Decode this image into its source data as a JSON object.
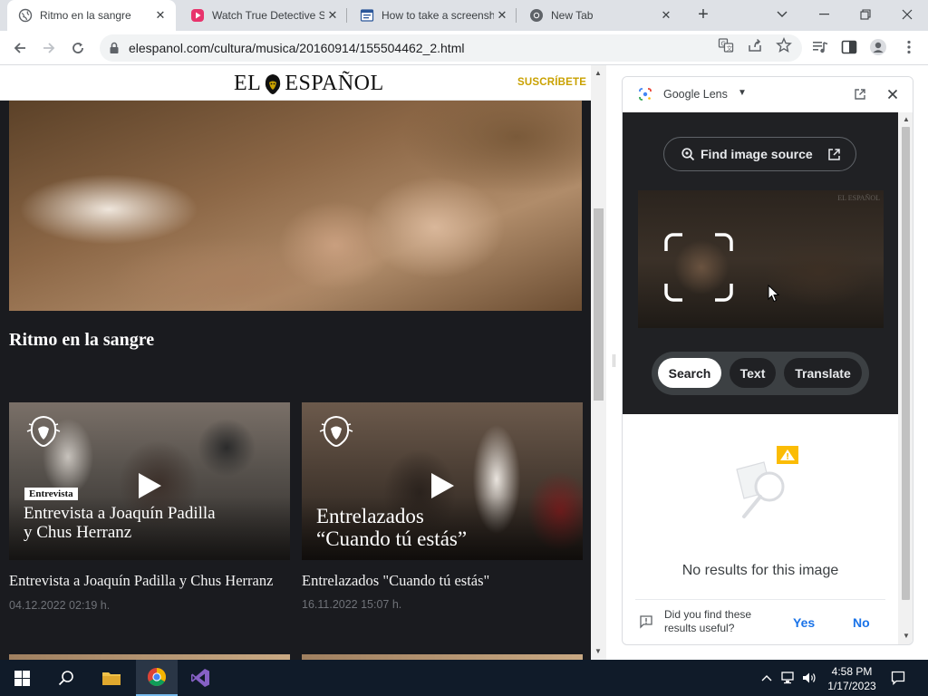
{
  "browser": {
    "tabs": [
      {
        "title": "Ritmo en la sangre",
        "active": true
      },
      {
        "title": "Watch True Detective S",
        "active": false
      },
      {
        "title": "How to take a screensh",
        "active": false
      },
      {
        "title": "New Tab",
        "active": false
      }
    ],
    "url": "elespanol.com/cultura/musica/20160914/155504462_2.html"
  },
  "site": {
    "logo_left": "EL",
    "logo_right": "ESPAÑOL",
    "subscribe": "SUSCRÍBETE",
    "headline": "Ritmo en la sangre",
    "cards": [
      {
        "tag": "Entrevista",
        "overlay_line1": "Entrevista a Joaquín Padilla",
        "overlay_line2": "y Chus Herranz",
        "title": "Entrevista a Joaquín Padilla y Chus Herranz",
        "date": "04.12.2022 02:19 h."
      },
      {
        "overlay_line1": "Entrelazados",
        "overlay_line2": "“Cuando tú estás”",
        "title": "Entrelazados \"Cuando tú estás\"",
        "date": "16.11.2022 15:07 h."
      }
    ]
  },
  "lens": {
    "title": "Google Lens",
    "find_source": "Find image source",
    "watermark": "EL ESPAÑOL",
    "modes": [
      "Search",
      "Text",
      "Translate"
    ],
    "selected_mode": "Search",
    "no_results": "No results for this image",
    "feedback_question": "Did you find these results useful?",
    "yes": "Yes",
    "no": "No"
  },
  "taskbar": {
    "time": "4:58 PM",
    "date": "1/17/2023"
  },
  "colors": {
    "accent_subscribe": "#c9a100",
    "lens_link": "#1a73e8",
    "page_bg": "#1a1b1f",
    "taskbar": "#101b29"
  }
}
